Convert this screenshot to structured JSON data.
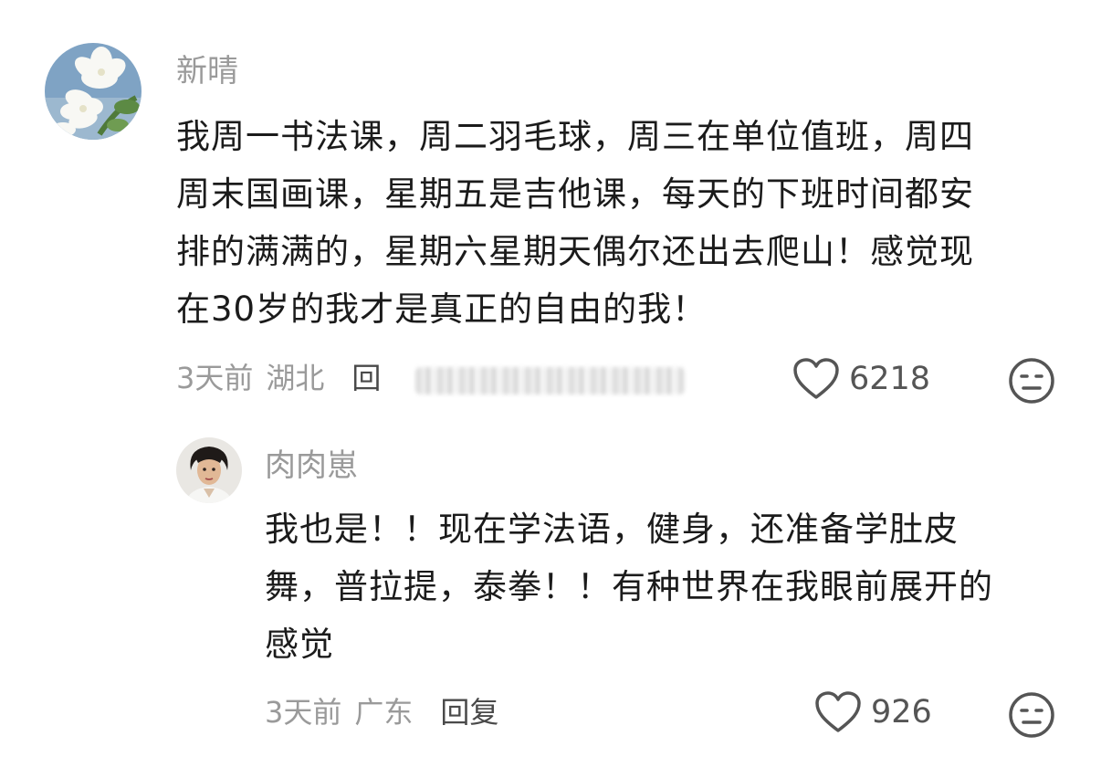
{
  "comments": [
    {
      "username": "新晴",
      "avatar_icon": "white-flower-avatar",
      "text_lines": [
        "我周一书法课，周二羽毛球，周三在单位值班，周四",
        "周末国画课，星期五是吉他课，每天的下班时间都安",
        "排的满满的，星期六星期天偶尔还出去爬山！感觉现",
        "在30岁的我才是真正的自由的我！"
      ],
      "time": "3天前",
      "location": "湖北",
      "reply_label": "回",
      "likes": "6218",
      "like_icon": "heart-outline-icon",
      "emoji_icon": "neutral-face-icon"
    },
    {
      "username": "肉肉崽",
      "avatar_icon": "woman-portrait-avatar",
      "text_lines": [
        "我也是！！现在学法语，健身，还准备学肚皮",
        "舞，普拉提，泰拳！！有种世界在我眼前展开的",
        "感觉"
      ],
      "time": "3天前",
      "location": "广东",
      "reply_label": "回复",
      "likes": "926",
      "like_icon": "heart-outline-icon",
      "emoji_icon": "neutral-face-icon"
    }
  ],
  "colors": {
    "username": "#9a9a9a",
    "text": "#1b1b1b",
    "meta": "#9a9a9a",
    "icon": "#555555"
  }
}
